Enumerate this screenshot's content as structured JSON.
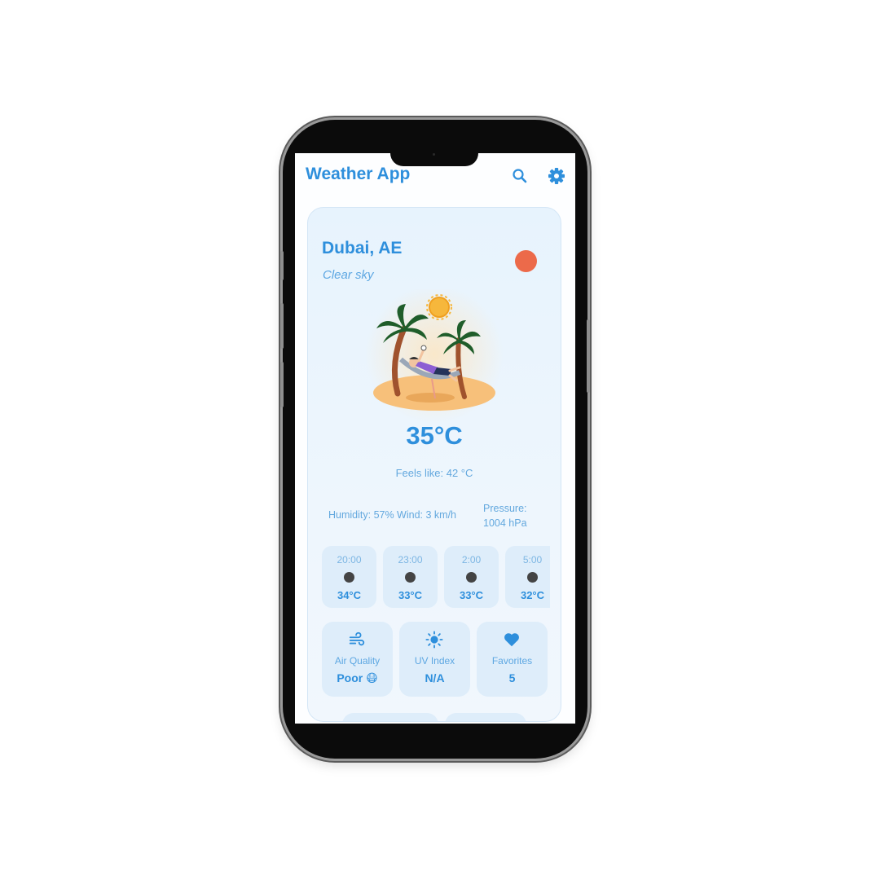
{
  "app": {
    "title": "Weather App",
    "accent": "#2e8fdc",
    "search_icon": "search-icon",
    "settings_icon": "gear-icon"
  },
  "current": {
    "location": "Dubai, AE",
    "condition": "Clear sky",
    "status_color": "#ec6a4a",
    "illustration": "beach-hammock-illustration",
    "temperature": "35°C",
    "feels_like": "Feels like: 42 °C",
    "humidity_wind": "Humidity: 57% Wind: 3 km/h",
    "pressure_label": "Pressure:",
    "pressure_value": "1004 hPa"
  },
  "hourly": [
    {
      "time": "20:00",
      "temp": "34°C"
    },
    {
      "time": "23:00",
      "temp": "33°C"
    },
    {
      "time": "2:00",
      "temp": "33°C"
    },
    {
      "time": "5:00",
      "temp": "32°C"
    }
  ],
  "tiles": [
    {
      "label": "Air Quality",
      "value": "Poor 😷",
      "icon": "wind-icon"
    },
    {
      "label": "UV Index",
      "value": "N/A",
      "icon": "sun-icon"
    },
    {
      "label": "Favorites",
      "value": "5",
      "icon": "heart-icon"
    }
  ]
}
